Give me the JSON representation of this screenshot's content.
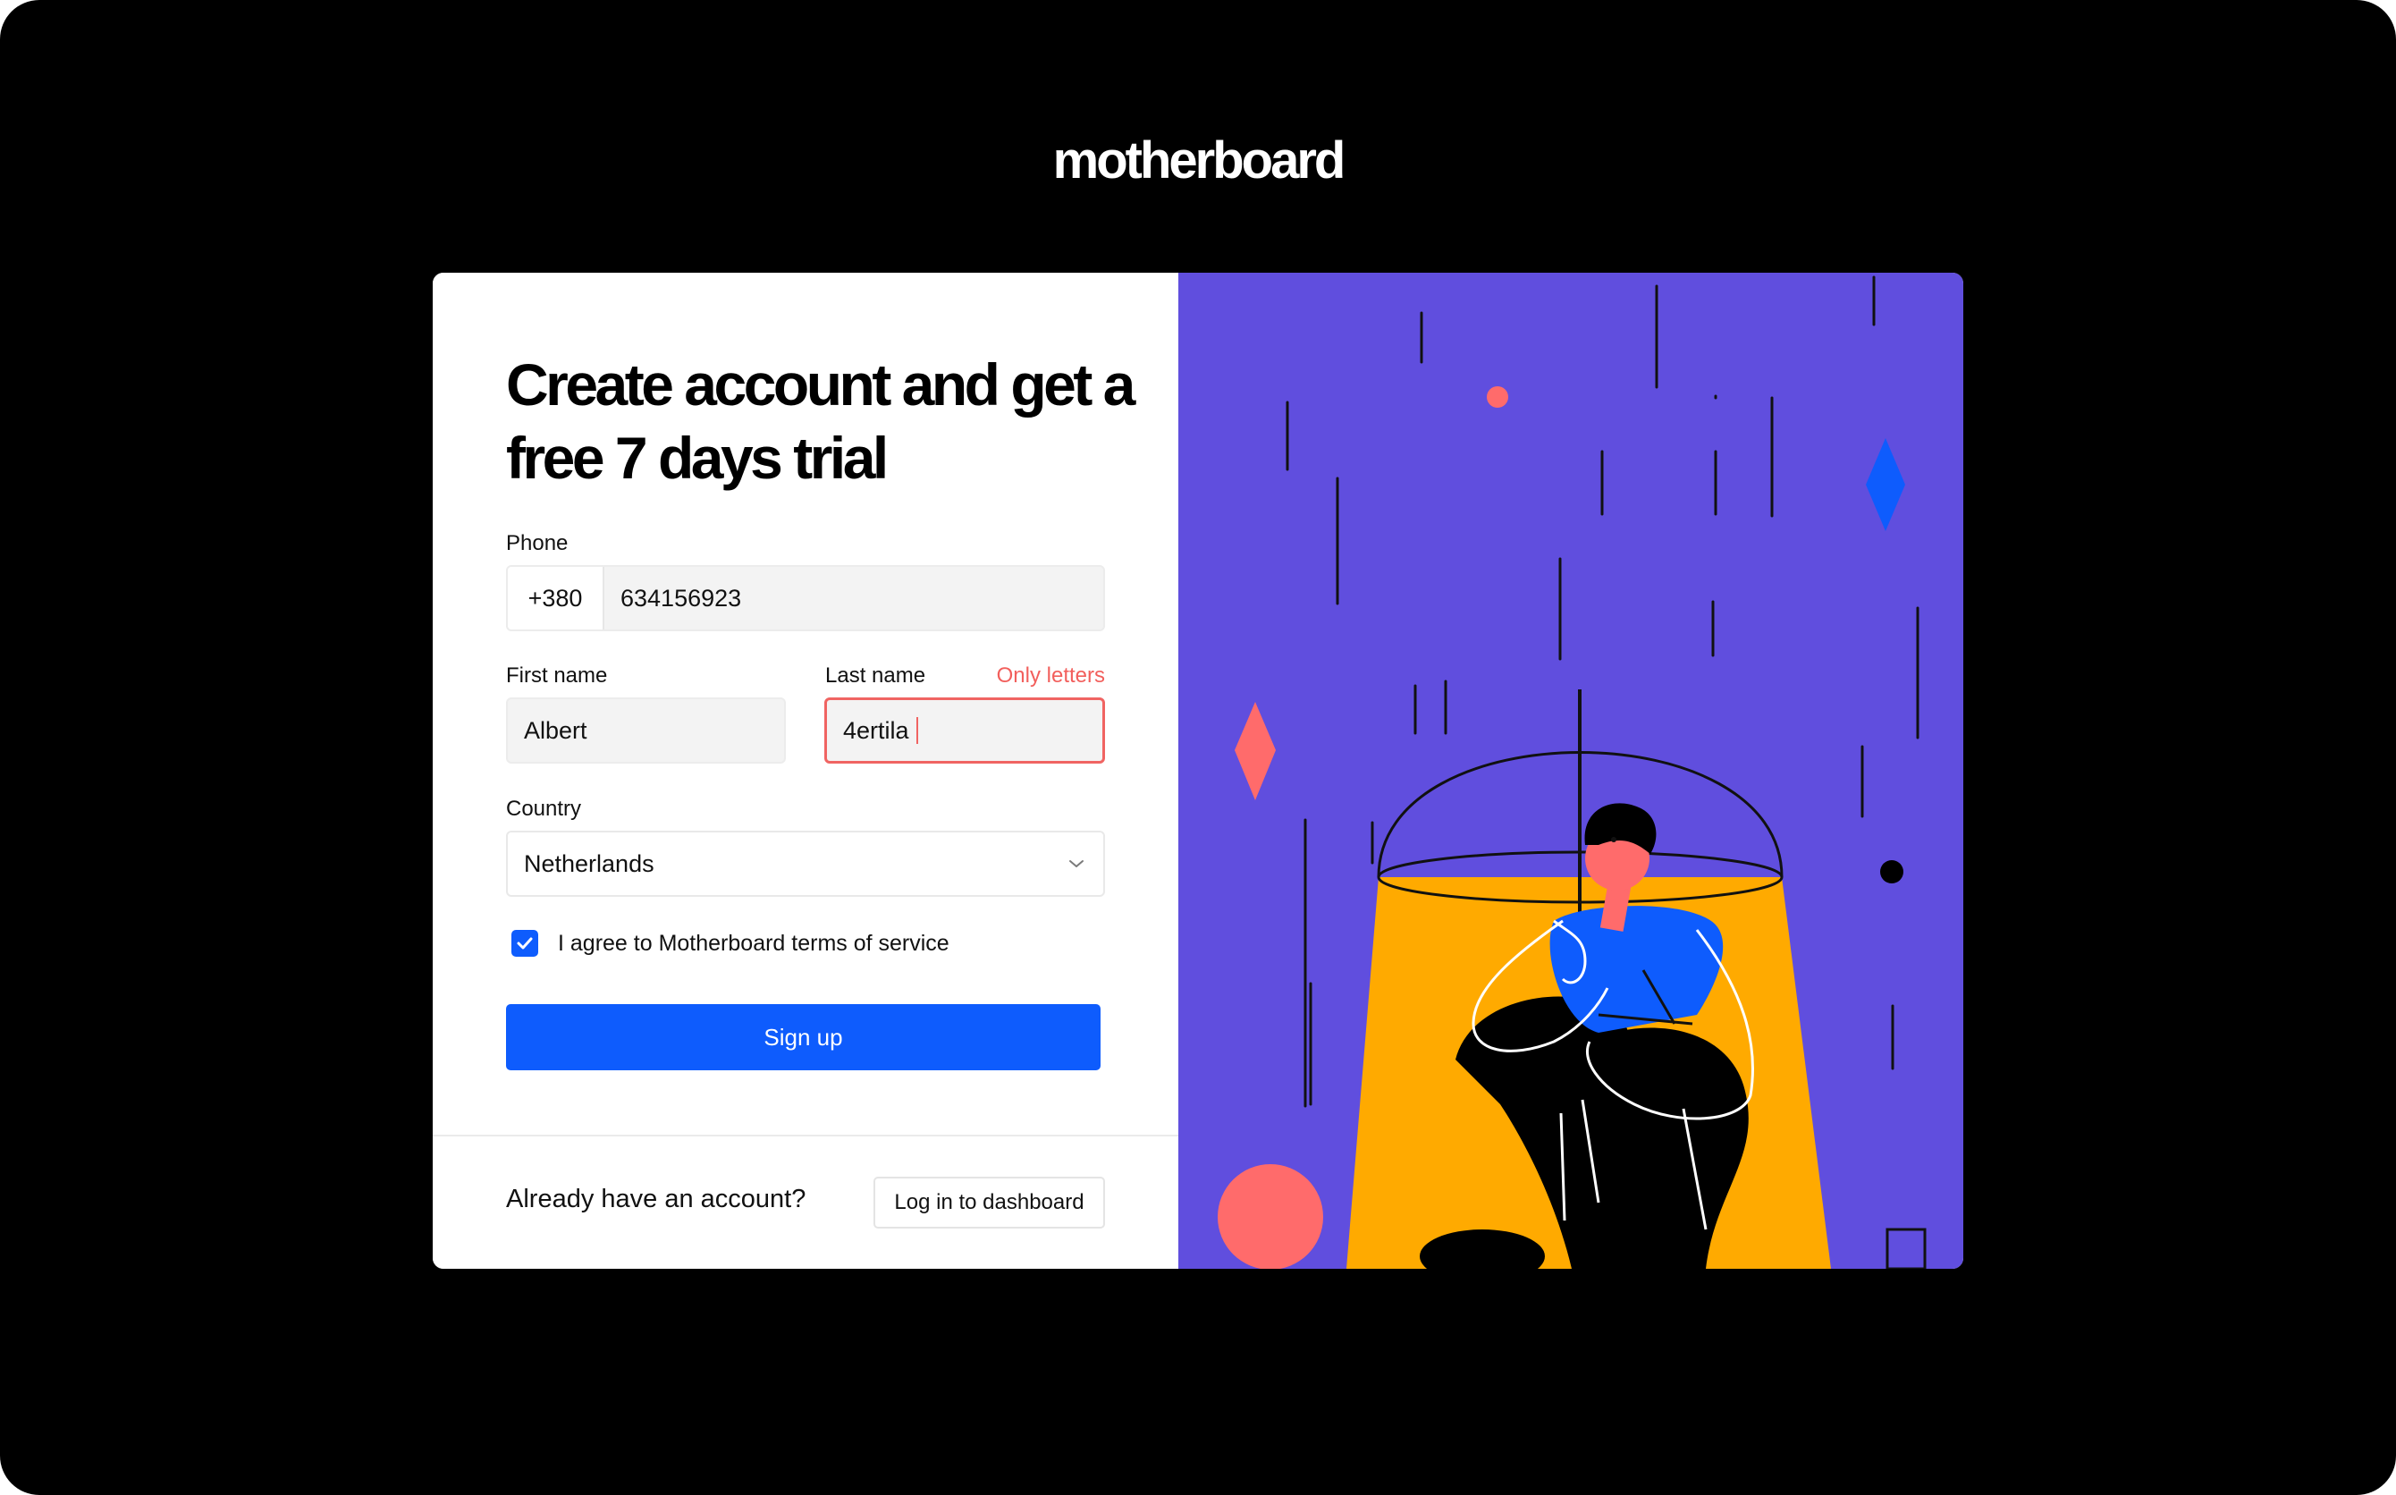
{
  "brand": {
    "logo_text": "motherboard"
  },
  "form": {
    "title": "Create account and get a free 7 days trial",
    "phone": {
      "label": "Phone",
      "country_code": "+380",
      "number": "634156923"
    },
    "first_name": {
      "label": "First name",
      "value": "Albert"
    },
    "last_name": {
      "label": "Last name",
      "value": "4ertila",
      "error": "Only letters"
    },
    "country": {
      "label": "Country",
      "value": "Netherlands",
      "icon": "chevron-down-icon"
    },
    "terms": {
      "checked": true,
      "label": "I agree to Motherboard terms of service"
    },
    "submit_label": "Sign up"
  },
  "footer": {
    "prompt": "Already have an account?",
    "login_label": "Log in to dashboard"
  },
  "colors": {
    "page_background": "#000000",
    "accent_blue": "#0e5cfd",
    "error_red": "#f06462",
    "illustration_purple": "#604ede",
    "illustration_yellow": "#ffaa00",
    "illustration_coral": "#ff6b6b"
  }
}
